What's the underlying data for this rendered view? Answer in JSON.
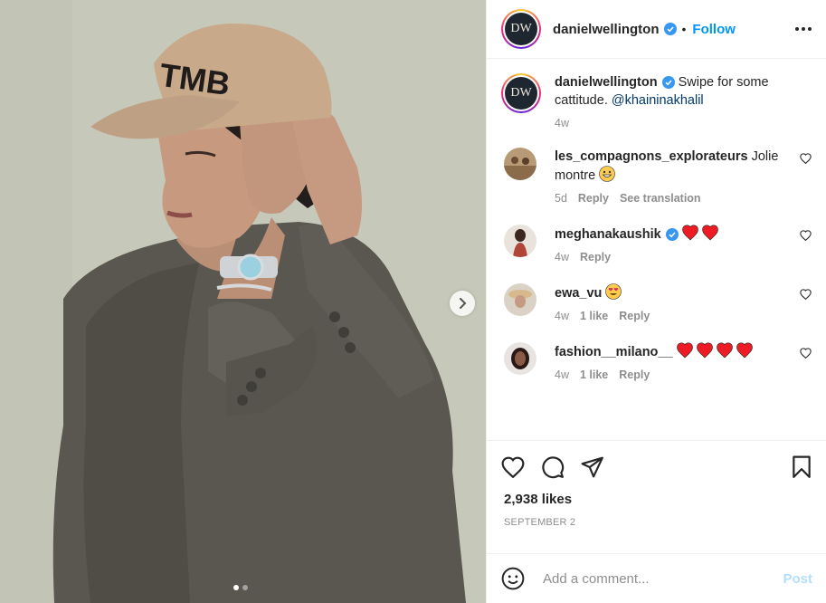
{
  "post": {
    "username": "danielwellington",
    "avatar_text": "DW",
    "follow_label": "Follow",
    "separator": "•",
    "caption_text": " Swipe for some cattitude. ",
    "caption_mention": "@khaininakhalil",
    "caption_age": "4w",
    "cap_letters": "TMB",
    "carousel": {
      "total": 2,
      "current": 1
    }
  },
  "comments": [
    {
      "username": "les_compagnons_explorateurs",
      "text": " Jolie montre ",
      "emoji": "grinning-face",
      "age": "5d",
      "likes": "",
      "reply": "Reply",
      "translate": "See translation",
      "verified": false
    },
    {
      "username": "meghanakaushik",
      "text": "",
      "emoji": "two-red-hearts",
      "age": "4w",
      "likes": "",
      "reply": "Reply",
      "translate": "",
      "verified": true
    },
    {
      "username": "ewa_vu",
      "text": "",
      "emoji": "heart-eyes",
      "age": "4w",
      "likes": "1 like",
      "reply": "Reply",
      "translate": "",
      "verified": false
    },
    {
      "username": "fashion__milano__",
      "text": "",
      "emoji": "four-red-hearts",
      "age": "4w",
      "likes": "1 like",
      "reply": "Reply",
      "translate": "",
      "verified": false
    }
  ],
  "actions": {
    "likes_count": "2,938 likes",
    "date": "SEPTEMBER 2"
  },
  "composer": {
    "placeholder": "Add a comment...",
    "post_label": "Post"
  },
  "colors": {
    "accent": "#0095f6",
    "post_disabled": "#b2dffc",
    "heart_red": "#ed1c24",
    "verified": "#3897f0"
  }
}
